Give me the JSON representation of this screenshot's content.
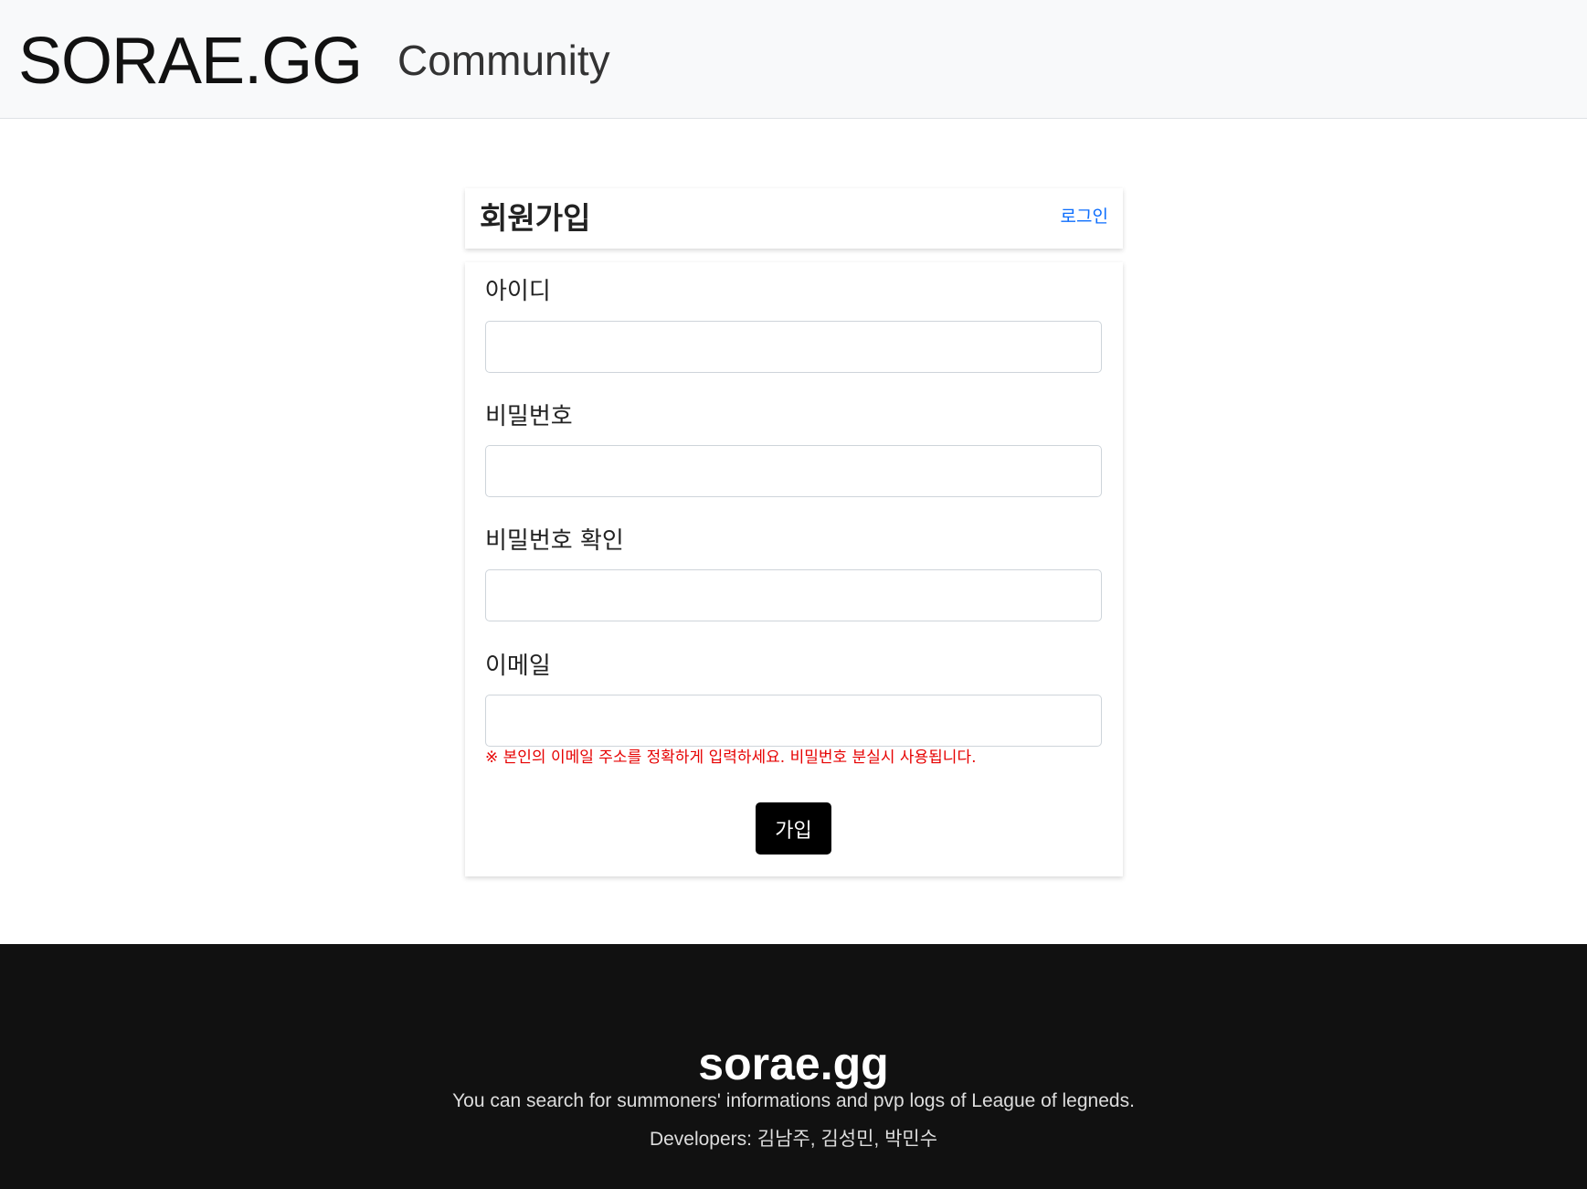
{
  "header": {
    "brand": "SORAE.GG",
    "nav_community": "Community"
  },
  "signup": {
    "title": "회원가입",
    "login_link": "로그인"
  },
  "form": {
    "fields": [
      {
        "label": "아이디",
        "value": ""
      },
      {
        "label": "비밀번호",
        "value": ""
      },
      {
        "label": "비밀번호 확인",
        "value": ""
      },
      {
        "label": "이메일",
        "value": ""
      }
    ],
    "email_note": "※ 본인의 이메일 주소를 정확하게 입력하세요. 비밀번호 분실시 사용됩니다.",
    "submit_label": "가입"
  },
  "footer": {
    "title": "sorae.gg",
    "description": "You can search for summoners' informations and pvp logs of League of legneds.",
    "developers": "Developers: 김남주, 김성민, 박민수"
  },
  "colors": {
    "header_bg": "#f8f9fa",
    "link": "#0d6efd",
    "warning_text": "#e60000",
    "button_bg": "#000000",
    "footer_bg": "#111111"
  }
}
